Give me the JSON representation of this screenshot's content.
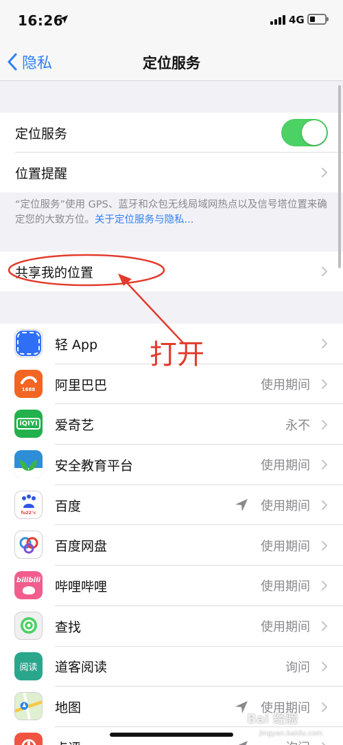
{
  "status_bar": {
    "time": "16:26",
    "network": "4G"
  },
  "nav": {
    "back_label": "隐私",
    "title": "定位服务"
  },
  "settings": {
    "location_services_label": "定位服务",
    "location_services_on": true,
    "location_reminders_label": "位置提醒",
    "footnote": "“定位服务”使用 GPS、蓝牙和众包无线局域网热点以及信号塔位置来确定您的大致方位。",
    "footnote_link": "关于定位服务与隐私...",
    "share_location_label": "共享我的位置"
  },
  "annotation": {
    "text": "打开",
    "color": "#e23b2c"
  },
  "apps": [
    {
      "name": "轻 App",
      "status": "",
      "icon": "qing-app-icon",
      "location_arrow": false
    },
    {
      "name": "阿里巴巴",
      "status": "使用期间",
      "icon": "alibaba-icon",
      "location_arrow": false
    },
    {
      "name": "爱奇艺",
      "status": "永不",
      "icon": "iqiyi-icon",
      "location_arrow": false
    },
    {
      "name": "安全教育平台",
      "status": "使用期间",
      "icon": "safety-education-icon",
      "location_arrow": false
    },
    {
      "name": "百度",
      "status": "使用期间",
      "icon": "baidu-icon",
      "location_arrow": true
    },
    {
      "name": "百度网盘",
      "status": "使用期间",
      "icon": "baidu-netdisk-icon",
      "location_arrow": false
    },
    {
      "name": "哔哩哔哩",
      "status": "使用期间",
      "icon": "bilibili-icon",
      "location_arrow": false
    },
    {
      "name": "查找",
      "status": "使用期间",
      "icon": "find-my-icon",
      "location_arrow": false
    },
    {
      "name": "道客阅读",
      "status": "询问",
      "icon": "doc88-reader-icon",
      "location_arrow": false
    },
    {
      "name": "地图",
      "status": "使用期间",
      "icon": "maps-icon",
      "location_arrow": true
    },
    {
      "name": "点评",
      "status": "询问",
      "icon": "dianping-icon",
      "location_arrow": true
    }
  ],
  "icon_text": {
    "iqiyi": "iQIYI",
    "alibaba_badge": "1688",
    "bilibili": "bilibili",
    "doc88": "阅读",
    "baidu_badge": "fu22°c"
  },
  "watermark": {
    "brand": "Bai 经验",
    "url": "jingyan.baidu.com"
  },
  "colors": {
    "accent": "#2f7ff5",
    "toggle_on": "#4cd164",
    "secondary_text": "#8a8a8e"
  }
}
